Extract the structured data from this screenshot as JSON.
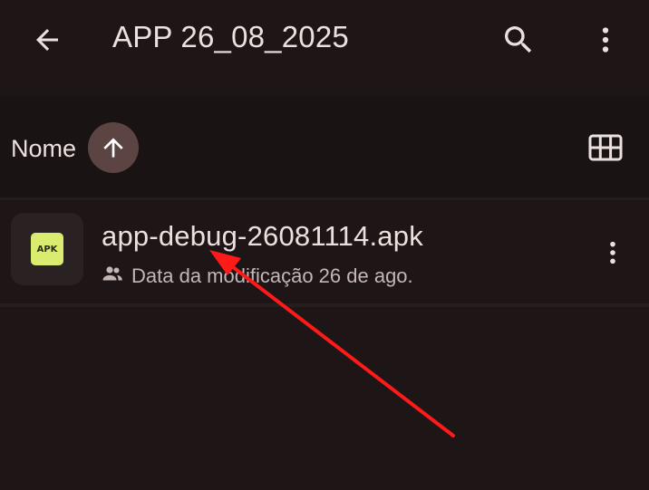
{
  "header": {
    "title": "APP 26_08_2025",
    "back_icon": "arrow-back-icon",
    "search_icon": "search-icon",
    "more_icon": "more-vert-icon"
  },
  "sort": {
    "label": "Nome",
    "direction_icon": "arrow-up-icon",
    "view_icon": "grid-view-icon"
  },
  "files": [
    {
      "name": "app-debug-26081114.apk",
      "badge": "APK",
      "meta": "Data da modificação 26 de ago.",
      "meta_icon": "people-icon",
      "more_icon": "more-vert-icon"
    }
  ],
  "colors": {
    "background": "#1e1616",
    "sort_button": "#5b4442",
    "apk_badge": "#d9ec70",
    "annotation_arrow": "#ff1a1a"
  }
}
